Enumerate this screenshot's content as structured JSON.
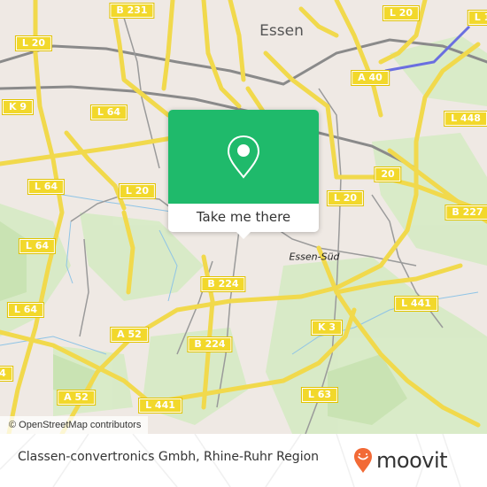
{
  "map": {
    "city_labels": {
      "essen": "Essen",
      "essen_sud": "Essen-Süd"
    },
    "road_labels": [
      {
        "id": "b231",
        "text": "B 231"
      },
      {
        "id": "l20-nw",
        "text": "L 20"
      },
      {
        "id": "l20-ne",
        "text": "L 20"
      },
      {
        "id": "l1-ne",
        "text": "L 1"
      },
      {
        "id": "k9",
        "text": "K 9"
      },
      {
        "id": "l64-n",
        "text": "L 64"
      },
      {
        "id": "a40",
        "text": "A 40"
      },
      {
        "id": "l448",
        "text": "L 448"
      },
      {
        "id": "l64-mid",
        "text": "L 64"
      },
      {
        "id": "l20-mid",
        "text": "L 20"
      },
      {
        "id": "l20-e",
        "text": "20"
      },
      {
        "id": "l20-se",
        "text": "L 20"
      },
      {
        "id": "b227",
        "text": "B 227"
      },
      {
        "id": "l64-w",
        "text": "L 64"
      },
      {
        "id": "b224-n",
        "text": "B 224"
      },
      {
        "id": "l64-sw",
        "text": "L 64"
      },
      {
        "id": "l441-e",
        "text": "L 441"
      },
      {
        "id": "a52-n",
        "text": "A 52"
      },
      {
        "id": "k3",
        "text": "K 3"
      },
      {
        "id": "b224-s",
        "text": "B 224"
      },
      {
        "id": "l4-w",
        "text": "4"
      },
      {
        "id": "a52-s",
        "text": "A 52"
      },
      {
        "id": "l63",
        "text": "L 63"
      },
      {
        "id": "l441-s",
        "text": "L 441"
      }
    ],
    "attribution": "© OpenStreetMap contributors",
    "popup": {
      "icon": "location-pin-icon",
      "button_label": "Take me there",
      "color": "#1fba6b"
    }
  },
  "footer": {
    "place_name": "Classen-convertronics Gmbh, Rhine-Ruhr Region",
    "brand": "moovit",
    "brand_icon": "moovit-logo-pin-icon",
    "brand_color": "#f26a36"
  }
}
